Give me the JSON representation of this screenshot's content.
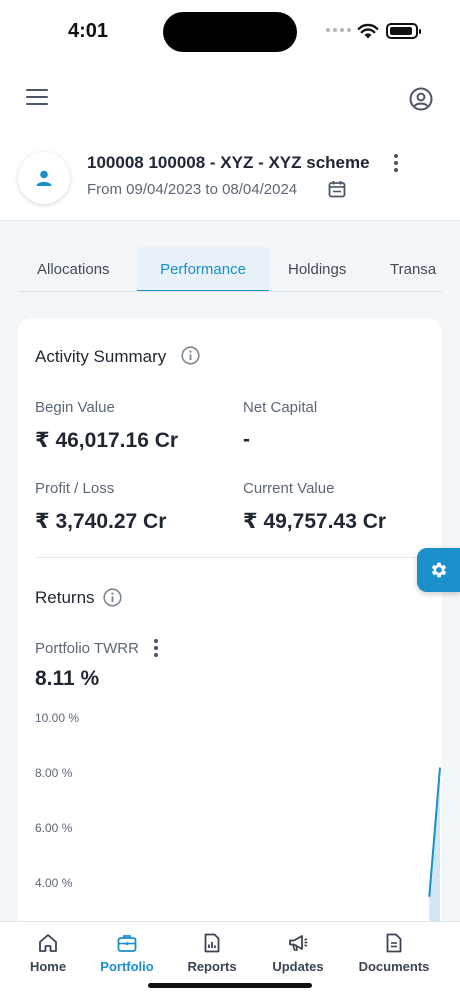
{
  "status_bar": {
    "time": "4:01"
  },
  "account": {
    "title": "100008 100008 - XYZ - XYZ scheme",
    "period": "From 09/04/2023 to 08/04/2024"
  },
  "tabs": [
    {
      "label": "Allocations",
      "active": false
    },
    {
      "label": "Performance",
      "active": true
    },
    {
      "label": "Holdings",
      "active": false
    },
    {
      "label": "Transa",
      "active": false
    }
  ],
  "activity_summary": {
    "title": "Activity Summary",
    "begin_value": {
      "label": "Begin Value",
      "value": "₹ 46,017.16 Cr"
    },
    "net_capital": {
      "label": "Net Capital",
      "value": "-"
    },
    "profit_loss": {
      "label": "Profit / Loss",
      "value": "₹ 3,740.27 Cr"
    },
    "current_value": {
      "label": "Current Value",
      "value": "₹ 49,757.43 Cr"
    }
  },
  "returns": {
    "title": "Returns",
    "twrr_label": "Portfolio TWRR",
    "twrr_value": "8.11 %"
  },
  "chart_data": {
    "type": "area",
    "title": "",
    "xlabel": "",
    "ylabel": "",
    "ylim": [
      3.0,
      10.0
    ],
    "y_ticks": [
      "10.00 %",
      "8.00 %",
      "6.00 %",
      "4.00 %"
    ],
    "y_tick_values": [
      10,
      8,
      6,
      4
    ],
    "x": [
      0.97,
      1.0
    ],
    "values": [
      3.5,
      8.2
    ],
    "grid": false,
    "line_color": "#1a8fc9",
    "fill_color": "#cfe6f5"
  },
  "bottom_nav": [
    {
      "label": "Home",
      "icon": "home-icon",
      "active": false
    },
    {
      "label": "Portfolio",
      "icon": "briefcase-icon",
      "active": true
    },
    {
      "label": "Reports",
      "icon": "report-icon",
      "active": false
    },
    {
      "label": "Updates",
      "icon": "megaphone-icon",
      "active": false
    },
    {
      "label": "Documents",
      "icon": "document-icon",
      "active": false
    }
  ],
  "colors": {
    "accent": "#1a8fc9",
    "text_primary": "#1f2733",
    "text_secondary": "#5c6776",
    "background": "#f3f6f9"
  }
}
